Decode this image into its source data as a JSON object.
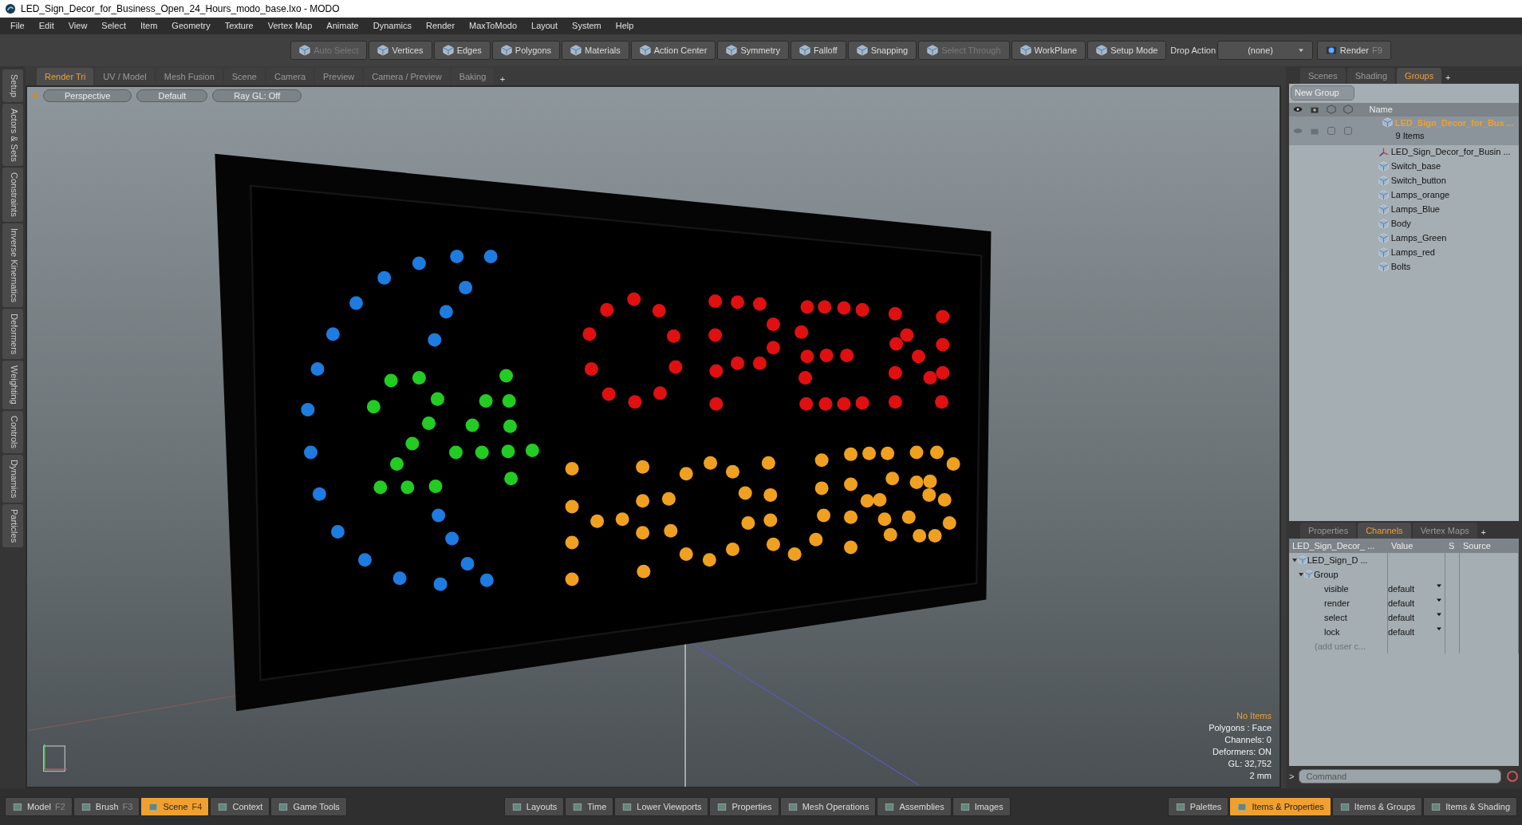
{
  "window": {
    "title": "LED_Sign_Decor_for_Business_Open_24_Hours_modo_base.lxo - MODO"
  },
  "menu": [
    "File",
    "Edit",
    "View",
    "Select",
    "Item",
    "Geometry",
    "Texture",
    "Vertex Map",
    "Animate",
    "Dynamics",
    "Render",
    "MaxToModo",
    "Layout",
    "System",
    "Help"
  ],
  "toolbar": [
    {
      "label": "Auto Select",
      "disabled": true
    },
    {
      "label": "Vertices",
      "disabled": false
    },
    {
      "label": "Edges",
      "disabled": false
    },
    {
      "label": "Polygons",
      "disabled": false
    },
    {
      "label": "Materials",
      "disabled": false
    },
    {
      "label": "Action Center",
      "disabled": false
    },
    {
      "label": "Symmetry",
      "disabled": false
    },
    {
      "label": "Falloff",
      "disabled": false
    },
    {
      "label": "Snapping",
      "disabled": false
    },
    {
      "label": "Select Through",
      "disabled": true
    },
    {
      "label": "WorkPlane",
      "disabled": false
    },
    {
      "label": "Setup Mode",
      "disabled": false
    }
  ],
  "drop_action": {
    "label": "Drop Action",
    "value": "(none)"
  },
  "render_button": {
    "label": "Render",
    "hotkey": "F9"
  },
  "viewport_tabs": [
    {
      "label": "Render Tri",
      "selected": true
    },
    {
      "label": "UV / Model",
      "selected": false
    },
    {
      "label": "Mesh Fusion",
      "selected": false
    },
    {
      "label": "Scene",
      "selected": false
    },
    {
      "label": "Camera",
      "selected": false
    },
    {
      "label": "Preview",
      "selected": false
    },
    {
      "label": "Camera / Preview",
      "selected": false
    },
    {
      "label": "Baking",
      "selected": false
    }
  ],
  "viewport_add_tab": "+",
  "viewport_header": [
    "Perspective",
    "Default",
    "Ray GL: Off"
  ],
  "left_tabs": [
    "Setup",
    "Actors & Sets",
    "Constraints",
    "Inverse Kinematics",
    "Deformers",
    "Weighting",
    "Controls",
    "Dynamics",
    "Particles"
  ],
  "viewport_info": [
    {
      "text": "No Items",
      "highlighted": true
    },
    {
      "text": "Polygons : Face",
      "highlighted": false
    },
    {
      "text": "Channels: 0",
      "highlighted": false
    },
    {
      "text": "Deformers: ON",
      "highlighted": false
    },
    {
      "text": "GL: 32,752",
      "highlighted": false
    },
    {
      "text": "2 mm",
      "highlighted": false
    }
  ],
  "groups_panel": {
    "tabs": [
      {
        "label": "Scenes",
        "selected": false
      },
      {
        "label": "Shading",
        "selected": false
      },
      {
        "label": "Groups",
        "selected": true
      }
    ],
    "add_tab": "+",
    "new_group": "New Group",
    "name_column": "Name",
    "group": {
      "name": "LED_Sign_Decor_for_Bus ...",
      "count": "9 Items",
      "children": [
        {
          "name": "LED_Sign_Decor_for_Busin ...",
          "kind": "locator"
        },
        {
          "name": "Switch_base",
          "kind": "mesh"
        },
        {
          "name": "Switch_button",
          "kind": "mesh"
        },
        {
          "name": "Lamps_orange",
          "kind": "mesh"
        },
        {
          "name": "Lamps_Blue",
          "kind": "mesh"
        },
        {
          "name": "Body",
          "kind": "mesh"
        },
        {
          "name": "Lamps_Green",
          "kind": "mesh"
        },
        {
          "name": "Lamps_red",
          "kind": "mesh"
        },
        {
          "name": "Bolts",
          "kind": "mesh"
        }
      ]
    }
  },
  "channels_panel": {
    "tabs": [
      {
        "label": "Properties",
        "selected": false
      },
      {
        "label": "Channels",
        "selected": true
      },
      {
        "label": "Vertex Maps",
        "selected": false
      }
    ],
    "add_tab": "+",
    "columns": [
      "LED_Sign_Decor_ ...",
      "Value",
      "S",
      "Source"
    ],
    "item": "LED_Sign_D ...",
    "group": "Group",
    "channels": [
      {
        "name": "visible",
        "value": "default"
      },
      {
        "name": "render",
        "value": "default"
      },
      {
        "name": "select",
        "value": "default"
      },
      {
        "name": "lock",
        "value": "default"
      }
    ],
    "add_user": "(add user c..."
  },
  "command": {
    "prompt": ">",
    "placeholder": "Command"
  },
  "bottom_bar": {
    "left": [
      {
        "label": "Model",
        "hotkey": "F2",
        "selected": false
      },
      {
        "label": "Brush",
        "hotkey": "F3",
        "selected": false
      },
      {
        "label": "Scene",
        "hotkey": "F4",
        "selected": true
      },
      {
        "label": "Context",
        "selected": false
      },
      {
        "label": "Game Tools",
        "selected": false
      }
    ],
    "center": [
      {
        "label": "Layouts",
        "selected": false
      },
      {
        "label": "Time",
        "selected": false
      },
      {
        "label": "Lower Viewports",
        "selected": false
      },
      {
        "label": "Properties",
        "selected": false
      },
      {
        "label": "Mesh Operations",
        "selected": false
      },
      {
        "label": "Assemblies",
        "selected": false
      },
      {
        "label": "Images",
        "selected": false
      }
    ],
    "right": [
      {
        "label": "Palettes",
        "selected": false
      },
      {
        "label": "Items & Properties",
        "selected": true
      },
      {
        "label": "Items & Groups",
        "selected": false
      },
      {
        "label": "Items & Shading",
        "selected": false
      }
    ]
  }
}
